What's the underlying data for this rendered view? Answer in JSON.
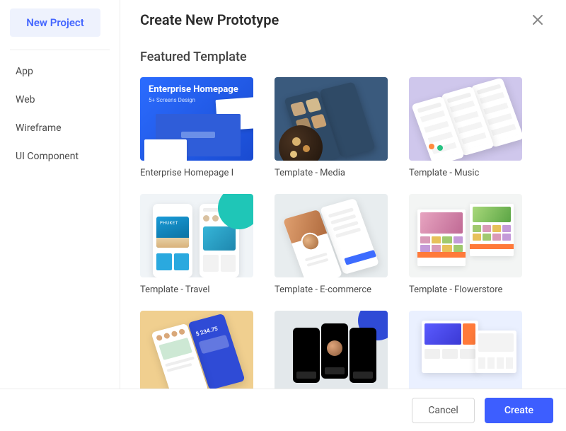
{
  "sidebar": {
    "new_project_label": "New Project",
    "items": [
      {
        "label": "App"
      },
      {
        "label": "Web"
      },
      {
        "label": "Wireframe"
      },
      {
        "label": "UI Component"
      }
    ]
  },
  "main": {
    "title": "Create New Prototype",
    "section_title": "Featured Template",
    "templates": [
      {
        "label": "Enterprise Homepage I",
        "thumb_headline": "Enterprise Homepage",
        "thumb_sub": "5+ Screens Design"
      },
      {
        "label": "Template - Media"
      },
      {
        "label": "Template - Music"
      },
      {
        "label": "Template - Travel",
        "thumb_tag": "PHUKET"
      },
      {
        "label": "Template - E-commerce"
      },
      {
        "label": "Template - Flowerstore"
      },
      {
        "label": "",
        "thumb_amount": "$ 234.75"
      },
      {
        "label": ""
      },
      {
        "label": ""
      }
    ]
  },
  "footer": {
    "cancel_label": "Cancel",
    "create_label": "Create"
  }
}
